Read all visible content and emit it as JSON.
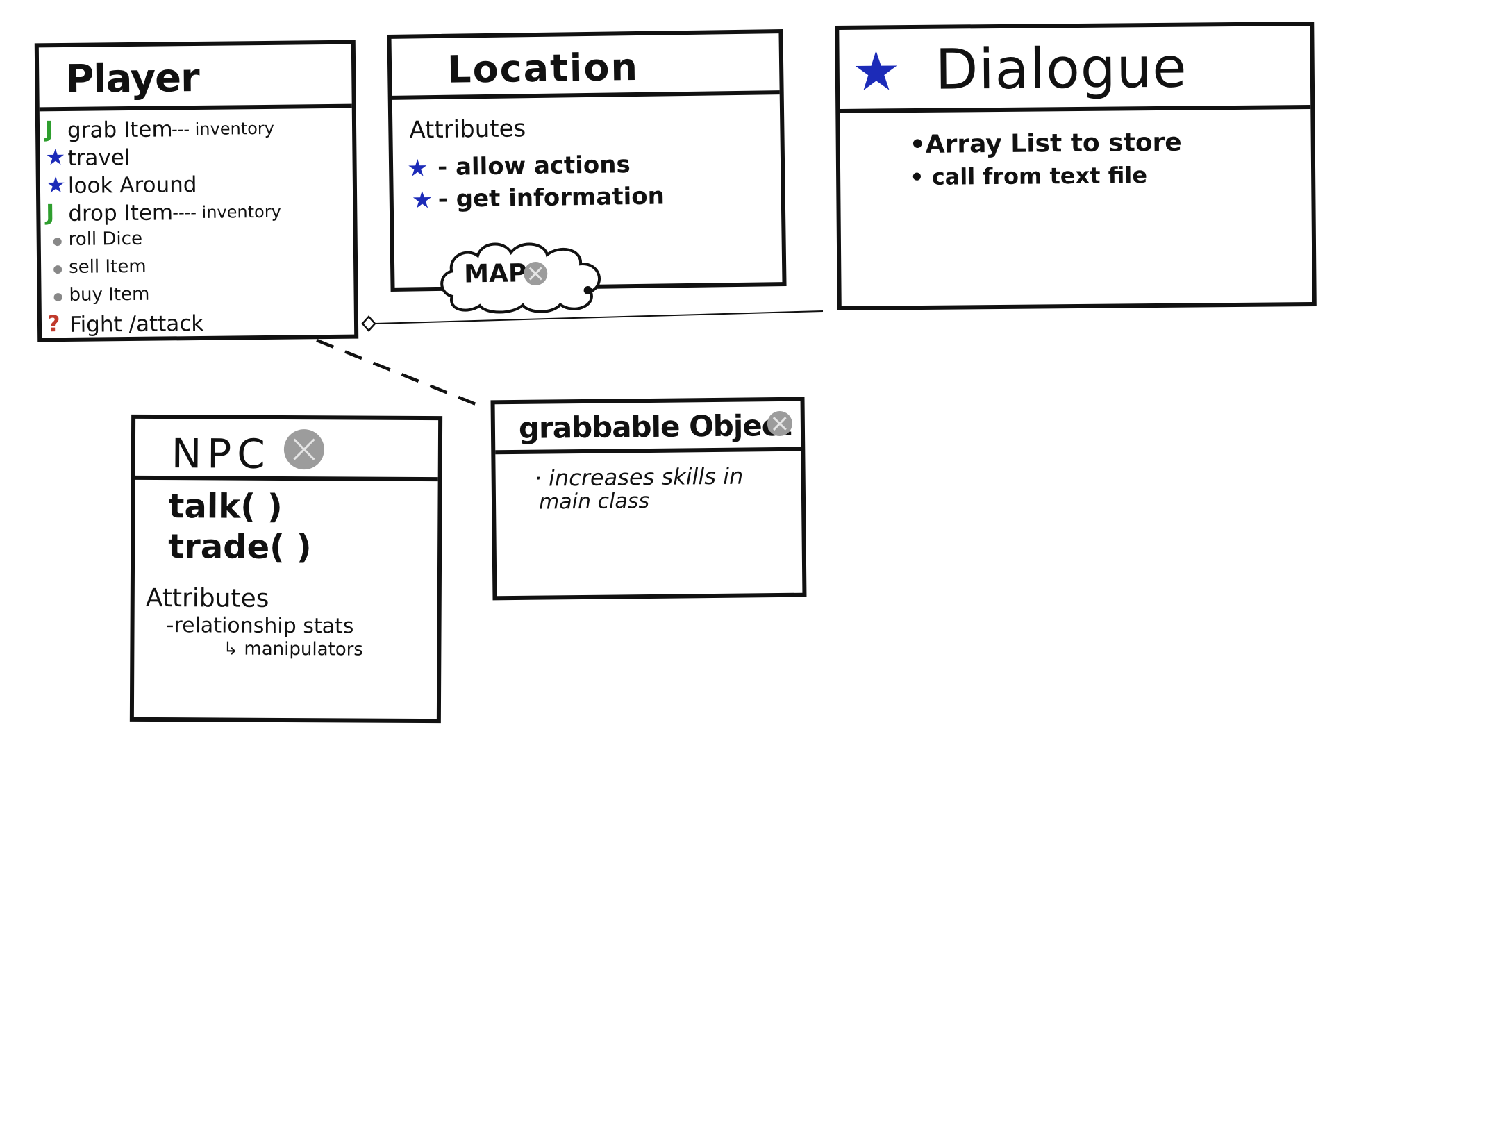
{
  "colors": {
    "ink": "#111111",
    "green_check": "#2e9e2e",
    "blue_star": "#1c2bb8",
    "gray_mark": "#8c8c8c",
    "red_question": "#c0392b"
  },
  "player": {
    "title": "Player",
    "items": [
      {
        "marker": "J",
        "marker_type": "green-check",
        "label": "grab Item",
        "note": "--- inventory"
      },
      {
        "marker": "★",
        "marker_type": "blue-star",
        "label": "travel",
        "note": ""
      },
      {
        "marker": "★",
        "marker_type": "blue-star",
        "label": "look Around",
        "note": ""
      },
      {
        "marker": "J",
        "marker_type": "green-check",
        "label": "drop Item",
        "note": "---- inventory"
      },
      {
        "marker": "",
        "marker_type": "gray-x",
        "label": "roll Dice",
        "note": ""
      },
      {
        "marker": "",
        "marker_type": "gray-x",
        "label": "sell Item",
        "note": ""
      },
      {
        "marker": "",
        "marker_type": "gray-x",
        "label": "buy Item",
        "note": ""
      },
      {
        "marker": "?",
        "marker_type": "red-question",
        "label": "Fight /attack",
        "note": ""
      }
    ]
  },
  "location": {
    "title": "Location",
    "attributes_label": "Attributes",
    "items": [
      {
        "marker": "★",
        "label": "- allow actions"
      },
      {
        "marker": "★",
        "label": "- get information"
      }
    ],
    "map_label": "MAP"
  },
  "dialogue": {
    "title": "Dialogue",
    "title_marker": "★",
    "items": [
      "•Array List to store",
      "• call from text file"
    ]
  },
  "npc": {
    "title": "NPC",
    "methods": [
      "talk( )",
      "trade( )"
    ],
    "attributes_label": "Attributes",
    "attribute_lines": [
      "-relationship stats",
      "↳ manipulators"
    ]
  },
  "grabbable": {
    "title": "grabbable Object",
    "lines": [
      "· increases skills in",
      "main class"
    ]
  }
}
